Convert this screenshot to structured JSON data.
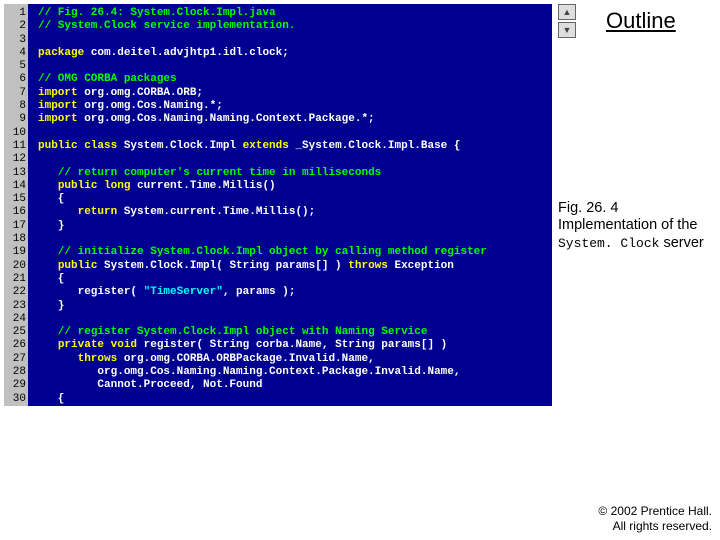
{
  "outline": "Outline",
  "caption": {
    "fig": "Fig. 26. 4",
    "body_pre": "Implementation of the ",
    "mono": "System. Clock",
    "body_post": " server"
  },
  "footer": {
    "line1": "© 2002 Prentice Hall.",
    "line2": "All rights reserved."
  },
  "code": {
    "lines": [
      {
        "n": 1,
        "segs": [
          {
            "cls": "c-green",
            "t": "// Fig. 26.4: System.Clock.Impl.java"
          }
        ]
      },
      {
        "n": 2,
        "segs": [
          {
            "cls": "c-green",
            "t": "// System.Clock service implementation."
          }
        ]
      },
      {
        "n": 3,
        "segs": []
      },
      {
        "n": 4,
        "segs": [
          {
            "cls": "c-yellow",
            "t": "package"
          },
          {
            "cls": "c-white",
            "t": " com.deitel.advjhtp1.idl.clock;"
          }
        ]
      },
      {
        "n": 5,
        "segs": []
      },
      {
        "n": 6,
        "segs": [
          {
            "cls": "c-green",
            "t": "// OMG CORBA packages"
          }
        ]
      },
      {
        "n": 7,
        "segs": [
          {
            "cls": "c-yellow",
            "t": "import"
          },
          {
            "cls": "c-white",
            "t": " org.omg.CORBA.ORB;"
          }
        ]
      },
      {
        "n": 8,
        "segs": [
          {
            "cls": "c-yellow",
            "t": "import"
          },
          {
            "cls": "c-white",
            "t": " org.omg.Cos.Naming.*;"
          }
        ]
      },
      {
        "n": 9,
        "segs": [
          {
            "cls": "c-yellow",
            "t": "import"
          },
          {
            "cls": "c-white",
            "t": " org.omg.Cos.Naming.Naming.Context.Package.*;"
          }
        ]
      },
      {
        "n": 10,
        "segs": []
      },
      {
        "n": 11,
        "segs": [
          {
            "cls": "c-yellow",
            "t": "public class"
          },
          {
            "cls": "c-white",
            "t": " System.Clock.Impl "
          },
          {
            "cls": "c-yellow",
            "t": "extends"
          },
          {
            "cls": "c-white",
            "t": " _System.Clock.Impl.Base {"
          }
        ]
      },
      {
        "n": 12,
        "segs": []
      },
      {
        "n": 13,
        "segs": [
          {
            "cls": "c-white",
            "t": "   "
          },
          {
            "cls": "c-green",
            "t": "// return computer's current time in milliseconds"
          }
        ]
      },
      {
        "n": 14,
        "segs": [
          {
            "cls": "c-white",
            "t": "   "
          },
          {
            "cls": "c-yellow",
            "t": "public long"
          },
          {
            "cls": "c-white",
            "t": " current.Time.Millis()"
          }
        ]
      },
      {
        "n": 15,
        "segs": [
          {
            "cls": "c-white",
            "t": "   {"
          }
        ]
      },
      {
        "n": 16,
        "segs": [
          {
            "cls": "c-white",
            "t": "      "
          },
          {
            "cls": "c-yellow",
            "t": "return"
          },
          {
            "cls": "c-white",
            "t": " System.current.Time.Millis();"
          }
        ]
      },
      {
        "n": 17,
        "segs": [
          {
            "cls": "c-white",
            "t": "   }"
          }
        ]
      },
      {
        "n": 18,
        "segs": []
      },
      {
        "n": 19,
        "segs": [
          {
            "cls": "c-white",
            "t": "   "
          },
          {
            "cls": "c-green",
            "t": "// initialize System.Clock.Impl object by calling method register"
          }
        ]
      },
      {
        "n": 20,
        "segs": [
          {
            "cls": "c-white",
            "t": "   "
          },
          {
            "cls": "c-yellow",
            "t": "public"
          },
          {
            "cls": "c-white",
            "t": " System.Clock.Impl( String params[] ) "
          },
          {
            "cls": "c-yellow",
            "t": "throws"
          },
          {
            "cls": "c-white",
            "t": " Exception"
          }
        ]
      },
      {
        "n": 21,
        "segs": [
          {
            "cls": "c-white",
            "t": "   {"
          }
        ]
      },
      {
        "n": 22,
        "segs": [
          {
            "cls": "c-white",
            "t": "      register( "
          },
          {
            "cls": "c-cyan",
            "t": "\"TimeServer\""
          },
          {
            "cls": "c-white",
            "t": ", params );"
          }
        ]
      },
      {
        "n": 23,
        "segs": [
          {
            "cls": "c-white",
            "t": "   }"
          }
        ]
      },
      {
        "n": 24,
        "segs": []
      },
      {
        "n": 25,
        "segs": [
          {
            "cls": "c-white",
            "t": "   "
          },
          {
            "cls": "c-green",
            "t": "// register System.Clock.Impl object with Naming Service"
          }
        ]
      },
      {
        "n": 26,
        "segs": [
          {
            "cls": "c-white",
            "t": "   "
          },
          {
            "cls": "c-yellow",
            "t": "private void"
          },
          {
            "cls": "c-white",
            "t": " register( String corba.Name, String params[] )"
          }
        ]
      },
      {
        "n": 27,
        "segs": [
          {
            "cls": "c-white",
            "t": "      "
          },
          {
            "cls": "c-yellow",
            "t": "throws"
          },
          {
            "cls": "c-white",
            "t": " org.omg.CORBA.ORBPackage.Invalid.Name,"
          }
        ]
      },
      {
        "n": 28,
        "segs": [
          {
            "cls": "c-white",
            "t": "         org.omg.Cos.Naming.Naming.Context.Package.Invalid.Name,"
          }
        ]
      },
      {
        "n": 29,
        "segs": [
          {
            "cls": "c-white",
            "t": "         Cannot.Proceed, Not.Found"
          }
        ]
      },
      {
        "n": 30,
        "segs": [
          {
            "cls": "c-white",
            "t": "   {"
          }
        ]
      }
    ]
  }
}
